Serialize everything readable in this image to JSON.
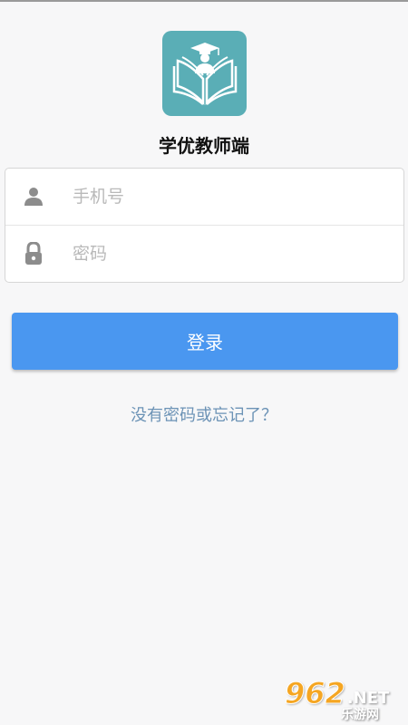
{
  "app": {
    "title": "学优教师端",
    "logo_icon": "open-book-graduate-icon",
    "logo_color": "#5aaeb6"
  },
  "login_form": {
    "phone": {
      "icon": "user-icon",
      "placeholder": "手机号",
      "value": ""
    },
    "password": {
      "icon": "lock-icon",
      "placeholder": "密码",
      "value": ""
    }
  },
  "login_button": {
    "label": "登录",
    "color": "#4a97f0"
  },
  "forgot_password": {
    "label": "没有密码或忘记了？",
    "color": "#6c93b6"
  },
  "watermark": {
    "number": "962",
    "suffix": ".NET",
    "site_name": "乐游网"
  }
}
